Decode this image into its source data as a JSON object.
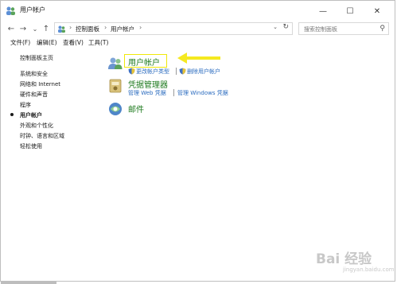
{
  "window": {
    "title": "用户帐户",
    "minimize": "—",
    "maximize": "☐",
    "close": "✕"
  },
  "nav": {
    "back": "←",
    "forward": "→",
    "recent": "⌄",
    "up": "↑",
    "breadcrumb": [
      "控制面板",
      "用户帐户"
    ],
    "separator": "›",
    "dropdown": "⌄",
    "refresh": "↻",
    "search_placeholder": "搜索控制面板",
    "search_glyph": "⚲"
  },
  "menu": [
    "文件(F)",
    "编辑(E)",
    "查看(V)",
    "工具(T)"
  ],
  "sidebar": {
    "home": "控制面板主页",
    "items": [
      "系统和安全",
      "网络和 Internet",
      "硬件和声音",
      "程序",
      "用户帐户",
      "外观和个性化",
      "时钟、语言和区域",
      "轻松使用"
    ],
    "current_index": 4
  },
  "categories": [
    {
      "title": "用户帐户",
      "icon": "users-icon",
      "links": [
        "更改帐户类型",
        "删除用户帐户"
      ]
    },
    {
      "title": "凭据管理器",
      "icon": "credential-manager-icon",
      "links": [
        "管理 Web 凭据",
        "管理 Windows 凭据"
      ]
    },
    {
      "title": "邮件",
      "icon": "mail-icon",
      "links": []
    }
  ],
  "watermark": {
    "text": "Bai 经验",
    "sub": "jingyan.baidu.com"
  },
  "colors": {
    "category": "#1e7a1e",
    "link": "#2a6bbf",
    "highlight": "#f0e80a"
  }
}
